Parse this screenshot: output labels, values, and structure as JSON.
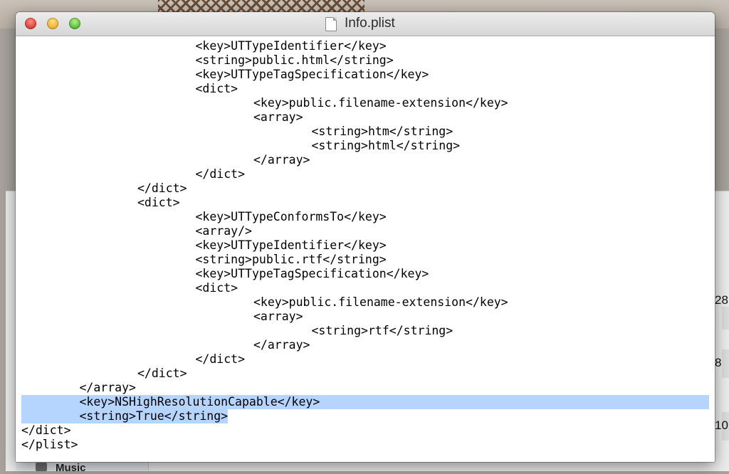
{
  "window": {
    "title": "Info.plist",
    "buttons": {
      "close": "close",
      "minimize": "minimize",
      "zoom": "zoom"
    }
  },
  "editor": {
    "selected_lines": [
      25,
      26
    ],
    "selection_color": "#b5d5ff",
    "lines": [
      "\t\t\t<key>UTTypeIdentifier</key>",
      "\t\t\t<string>public.html</string>",
      "\t\t\t<key>UTTypeTagSpecification</key>",
      "\t\t\t<dict>",
      "\t\t\t\t<key>public.filename-extension</key>",
      "\t\t\t\t<array>",
      "\t\t\t\t\t<string>htm</string>",
      "\t\t\t\t\t<string>html</string>",
      "\t\t\t\t</array>",
      "\t\t\t</dict>",
      "\t\t</dict>",
      "\t\t<dict>",
      "\t\t\t<key>UTTypeConformsTo</key>",
      "\t\t\t<array/>",
      "\t\t\t<key>UTTypeIdentifier</key>",
      "\t\t\t<string>public.rtf</string>",
      "\t\t\t<key>UTTypeTagSpecification</key>",
      "\t\t\t<dict>",
      "\t\t\t\t<key>public.filename-extension</key>",
      "\t\t\t\t<array>",
      "\t\t\t\t\t<string>rtf</string>",
      "\t\t\t\t</array>",
      "\t\t\t</dict>",
      "\t\t</dict>",
      "\t</array>",
      "\t<key>NSHighResolutionCapable</key>",
      "\t<string>True</string>",
      "</dict>",
      "</plist>"
    ]
  },
  "background": {
    "partial_numbers": [
      "28",
      "8",
      "10"
    ],
    "sidebar_item": "Music"
  }
}
